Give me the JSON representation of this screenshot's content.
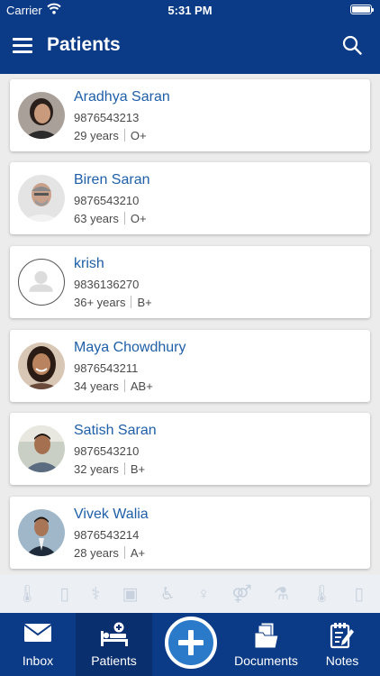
{
  "status_bar": {
    "carrier": "Carrier",
    "time": "5:31 PM"
  },
  "header": {
    "title": "Patients",
    "menu_icon": "hamburger-menu-icon",
    "search_icon": "search-icon"
  },
  "patients": [
    {
      "name": "Aradhya Saran",
      "phone": "9876543213",
      "age": "29 years",
      "blood": "O+"
    },
    {
      "name": "Biren Saran",
      "phone": "9876543210",
      "age": "63 years",
      "blood": "O+"
    },
    {
      "name": "krish",
      "phone": "9836136270",
      "age": "36+ years",
      "blood": "B+"
    },
    {
      "name": "Maya Chowdhury",
      "phone": "9876543211",
      "age": "34 years",
      "blood": "AB+"
    },
    {
      "name": "Satish Saran",
      "phone": "9876543210",
      "age": "32 years",
      "blood": "B+"
    },
    {
      "name": "Vivek Walia",
      "phone": "9876543214",
      "age": "28 years",
      "blood": "A+"
    }
  ],
  "tabs": [
    {
      "label": "Inbox",
      "icon": "mail-icon"
    },
    {
      "label": "Patients",
      "icon": "patient-bed-icon",
      "active": true
    },
    {
      "label": "",
      "icon": "add-circle-icon"
    },
    {
      "label": "Documents",
      "icon": "documents-icon"
    },
    {
      "label": "Notes",
      "icon": "notes-icon"
    }
  ],
  "colors": {
    "primary": "#0b3a86",
    "name_link": "#1e5fa8",
    "add_button": "#2a7ac9",
    "background": "#ececec"
  }
}
